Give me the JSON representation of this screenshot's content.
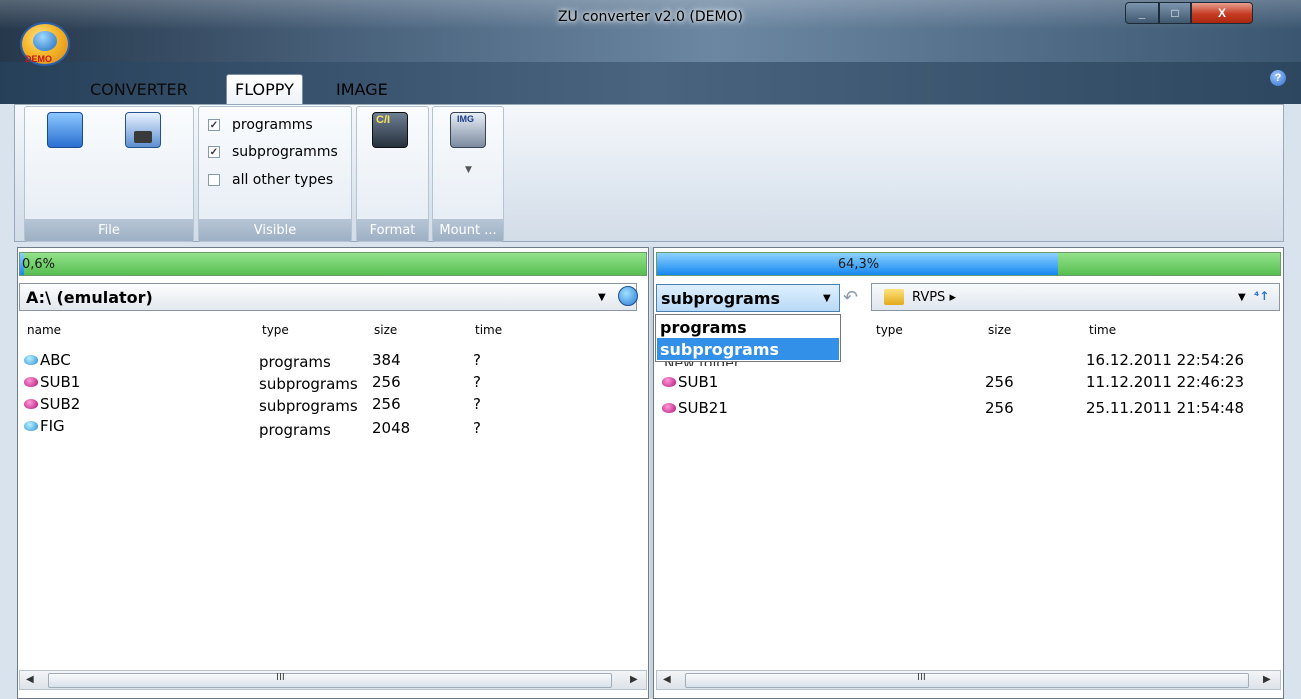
{
  "window": {
    "title": "ZU converter v2.0 (DEMO)",
    "logo_text": "DEMO",
    "min_label": "_",
    "max_label": "□",
    "close_label": "X"
  },
  "tabs": [
    {
      "label": "CONVERTER"
    },
    {
      "label": "FLOPPY"
    },
    {
      "label": "IMAGE"
    }
  ],
  "help_label": "?",
  "ribbon": {
    "groups": [
      {
        "label": "File"
      },
      {
        "label": "Visible"
      },
      {
        "label": "Format"
      },
      {
        "label": "Mount ..."
      }
    ],
    "checkboxes": [
      {
        "label": "programms",
        "checked": true,
        "mark": "✓"
      },
      {
        "label": "subprogramms",
        "checked": true,
        "mark": "✓"
      },
      {
        "label": "all other types",
        "checked": false,
        "mark": ""
      }
    ],
    "mount_arrow": "▼"
  },
  "left_panel": {
    "progress_text": "0,6%",
    "progress_fraction": 0.006,
    "path": "A:\\ (emulator)",
    "columns": [
      "name",
      "type",
      "size",
      "time"
    ],
    "files": [
      {
        "name": "ABC",
        "type": "programs",
        "size": "384",
        "time": "?",
        "kind": "prog"
      },
      {
        "name": "SUB1",
        "type": "subprograms",
        "size": "256",
        "time": "?",
        "kind": "sub"
      },
      {
        "name": "SUB2",
        "type": "subprograms",
        "size": "256",
        "time": "?",
        "kind": "sub"
      },
      {
        "name": "FIG",
        "type": "programs",
        "size": "2048",
        "time": "?",
        "kind": "prog"
      }
    ],
    "scroll_grip": "III"
  },
  "right_panel": {
    "progress_text": "64,3%",
    "progress_fraction": 0.643,
    "filter_value": "subprograms",
    "filter_options": [
      "programs",
      "subprograms"
    ],
    "breadcrumb": "RVPS ▸",
    "refresh_label": "⁴↑",
    "columns": [
      "type",
      "size",
      "time"
    ],
    "new_folder_label": "New folder",
    "new_folder_time": "16.12.2011 22:54:26",
    "files": [
      {
        "name": "SUB1",
        "size": "256",
        "time": "11.12.2011 22:46:23",
        "kind": "sub"
      },
      {
        "name": "SUB21",
        "size": "256",
        "time": "25.11.2011 21:54:48",
        "kind": "sub"
      }
    ],
    "scroll_grip": "III"
  },
  "colors": {
    "accent": "#3390e8",
    "progress_green": "#57be50",
    "progress_blue": "#1587f0"
  }
}
